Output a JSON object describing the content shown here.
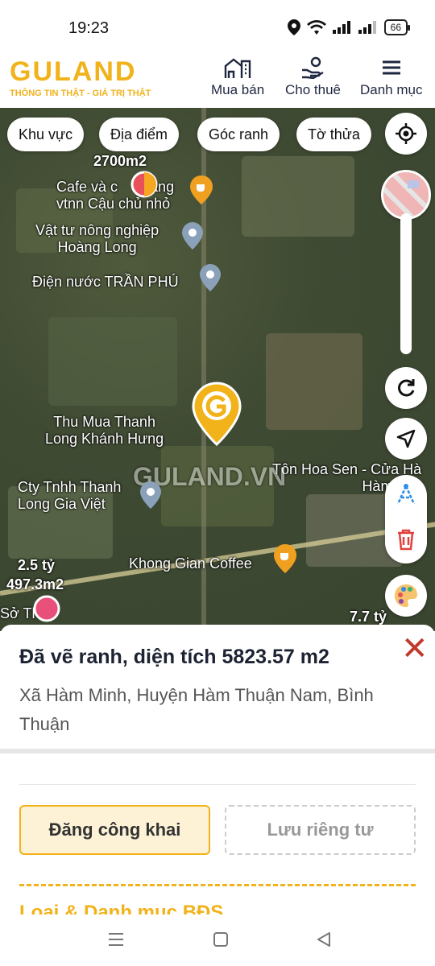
{
  "status_bar": {
    "time": "19:23",
    "battery": "66"
  },
  "header": {
    "logo_text": "GULAND",
    "tagline": "THÔNG TIN THẬT - GIÁ TRỊ THẬT",
    "nav": [
      {
        "label": "Mua bán",
        "icon": "building-icon"
      },
      {
        "label": "Cho thuê",
        "icon": "handshake-icon"
      },
      {
        "label": "Danh mục",
        "icon": "menu-icon"
      }
    ]
  },
  "map": {
    "filters": [
      "Khu vực",
      "Địa điểm",
      "Góc ranh",
      "Tờ thửa"
    ],
    "labels": {
      "price_area_top": "2700m2",
      "cafe": "Cafe và c        àng\nvtnn Cậu chủ nhỏ",
      "vat_tu": "Vật tư nông nghiệp\nHoàng Long",
      "dien_nuoc": "Điện nước TRẦN PHÚ",
      "thu_mua": "Thu Mua Thanh\nLong Khánh Hưng",
      "cty": "Cty Tnhh Thanh\nLong Gia Việt",
      "ton_hoa_sen": "Tôn Hoa Sen - Cửa Hà\nHàm Thu",
      "khong_gian": "Khong Gian Coffee",
      "price_left": "2.5 tỷ",
      "area_left": "497.3m2",
      "so_th": "Sở Th",
      "price_right": "7.7 tỷ",
      "watermark": "GULAND.VN"
    }
  },
  "sheet": {
    "title": "Đã vẽ ranh, diện tích 5823.57 m2",
    "address": "Xã Hàm Minh, Huyện Hàm Thuận Nam, Bình Thuận",
    "btn_public": "Đăng công khai",
    "btn_private": "Lưu riêng tư",
    "section_head": "Loại & Danh mục BĐS"
  },
  "colors": {
    "brand": "#f1b21a",
    "close": "#c0392b"
  }
}
